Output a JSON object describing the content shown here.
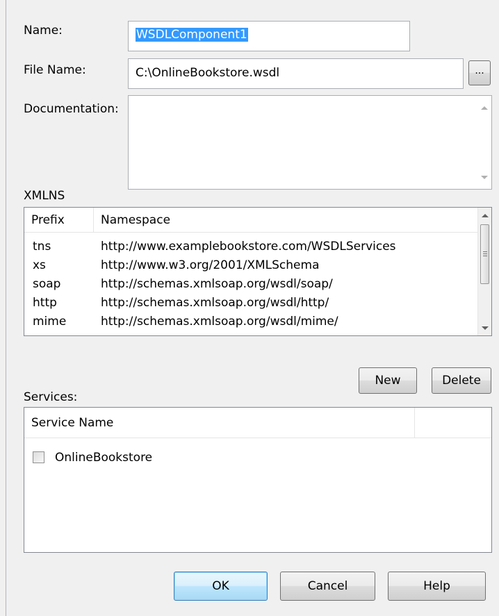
{
  "form": {
    "name_label": "Name:",
    "name_value": "WSDLComponent1",
    "filename_label": "File Name:",
    "filename_value": "C:\\OnlineBookstore.wsdl",
    "browse_label": "...",
    "documentation_label": "Documentation:",
    "documentation_value": ""
  },
  "xmlns": {
    "label": "XMLNS",
    "columns": [
      "Prefix",
      "Namespace"
    ],
    "rows": [
      {
        "prefix": "tns",
        "namespace": "http://www.examplebookstore.com/WSDLServices"
      },
      {
        "prefix": "xs",
        "namespace": "http://www.w3.org/2001/XMLSchema"
      },
      {
        "prefix": "soap",
        "namespace": "http://schemas.xmlsoap.org/wsdl/soap/"
      },
      {
        "prefix": "http",
        "namespace": "http://schemas.xmlsoap.org/wsdl/http/"
      },
      {
        "prefix": "mime",
        "namespace": "http://schemas.xmlsoap.org/wsdl/mime/"
      }
    ],
    "new_label": "New",
    "delete_label": "Delete"
  },
  "services": {
    "label": "Services:",
    "column": "Service Name",
    "items": [
      {
        "name": "OnlineBookstore",
        "checked": false
      }
    ]
  },
  "footer": {
    "ok_label": "OK",
    "cancel_label": "Cancel",
    "help_label": "Help"
  }
}
